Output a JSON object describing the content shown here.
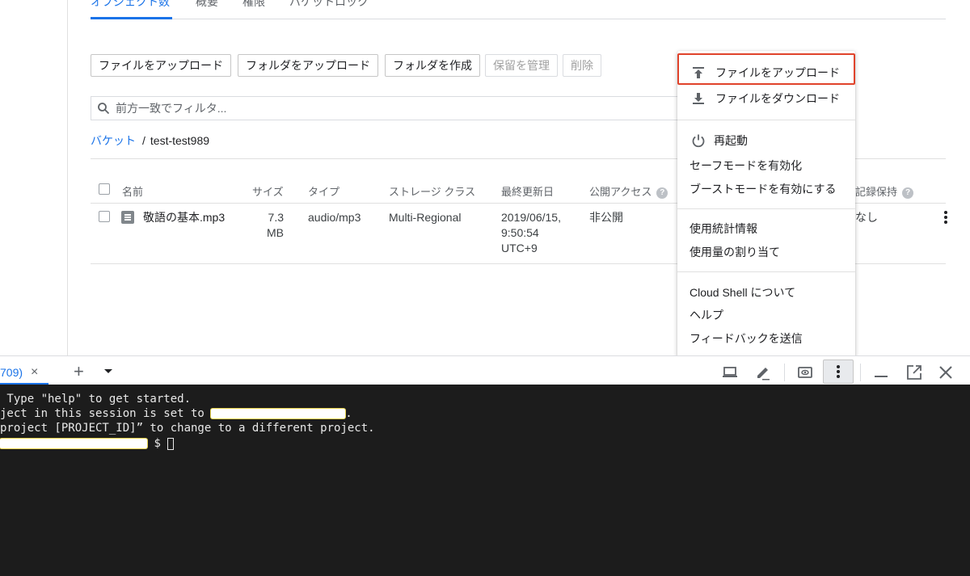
{
  "tabs": [
    "オブジェクト数",
    "概要",
    "権限",
    "バケットロック"
  ],
  "toolbar": {
    "upload_files": "ファイルをアップロード",
    "upload_folder": "フォルダをアップロード",
    "create_folder": "フォルダを作成",
    "manage_holds": "保留を管理",
    "delete": "削除"
  },
  "filter": {
    "placeholder": "前方一致でフィルタ..."
  },
  "breadcrumb": {
    "root": "バケット",
    "separator": "/",
    "bucket": "test-test989"
  },
  "table": {
    "headers": {
      "name": "名前",
      "size": "サイズ",
      "type": "タイプ",
      "storage_class": "ストレージ クラス",
      "last_modified": "最終更新日",
      "public_access": "公開アクセス",
      "retention": "記録保持"
    },
    "rows": [
      {
        "name": "敬語の基本.mp3",
        "size_line1": "7.3",
        "size_line2": "MB",
        "type": "audio/mp3",
        "storage_class": "Multi-Regional",
        "modified_line1": "2019/06/15,",
        "modified_line2": "9:50:54",
        "modified_line3": "UTC+9",
        "public_access": "非公開",
        "retention": "なし"
      }
    ]
  },
  "menu": {
    "upload_file": "ファイルをアップロード",
    "download_file": "ファイルをダウンロード",
    "restart": "再起動",
    "safe_mode": "セーフモードを有効化",
    "boost_mode": "ブーストモードを有効にする",
    "usage_stats": "使用統計情報",
    "usage_quota": "使用量の割り当て",
    "about": "Cloud Shell について",
    "help": "ヘルプ",
    "feedback": "フィードバックを送信"
  },
  "shell": {
    "tab_label": "709)",
    "close": "×",
    "new_tab": "+"
  },
  "terminal": {
    "line1": " Type \"help\" to get started.",
    "line2_pre": "ject in this session is set to ",
    "line2_post": ".",
    "line3": "project [PROJECT_ID]” to change to a different project.",
    "prompt_suffix": "$ "
  },
  "colors": {
    "accent": "#1a73e8",
    "highlight": "#e0432b",
    "terminal_bg": "#1c1c1c"
  }
}
